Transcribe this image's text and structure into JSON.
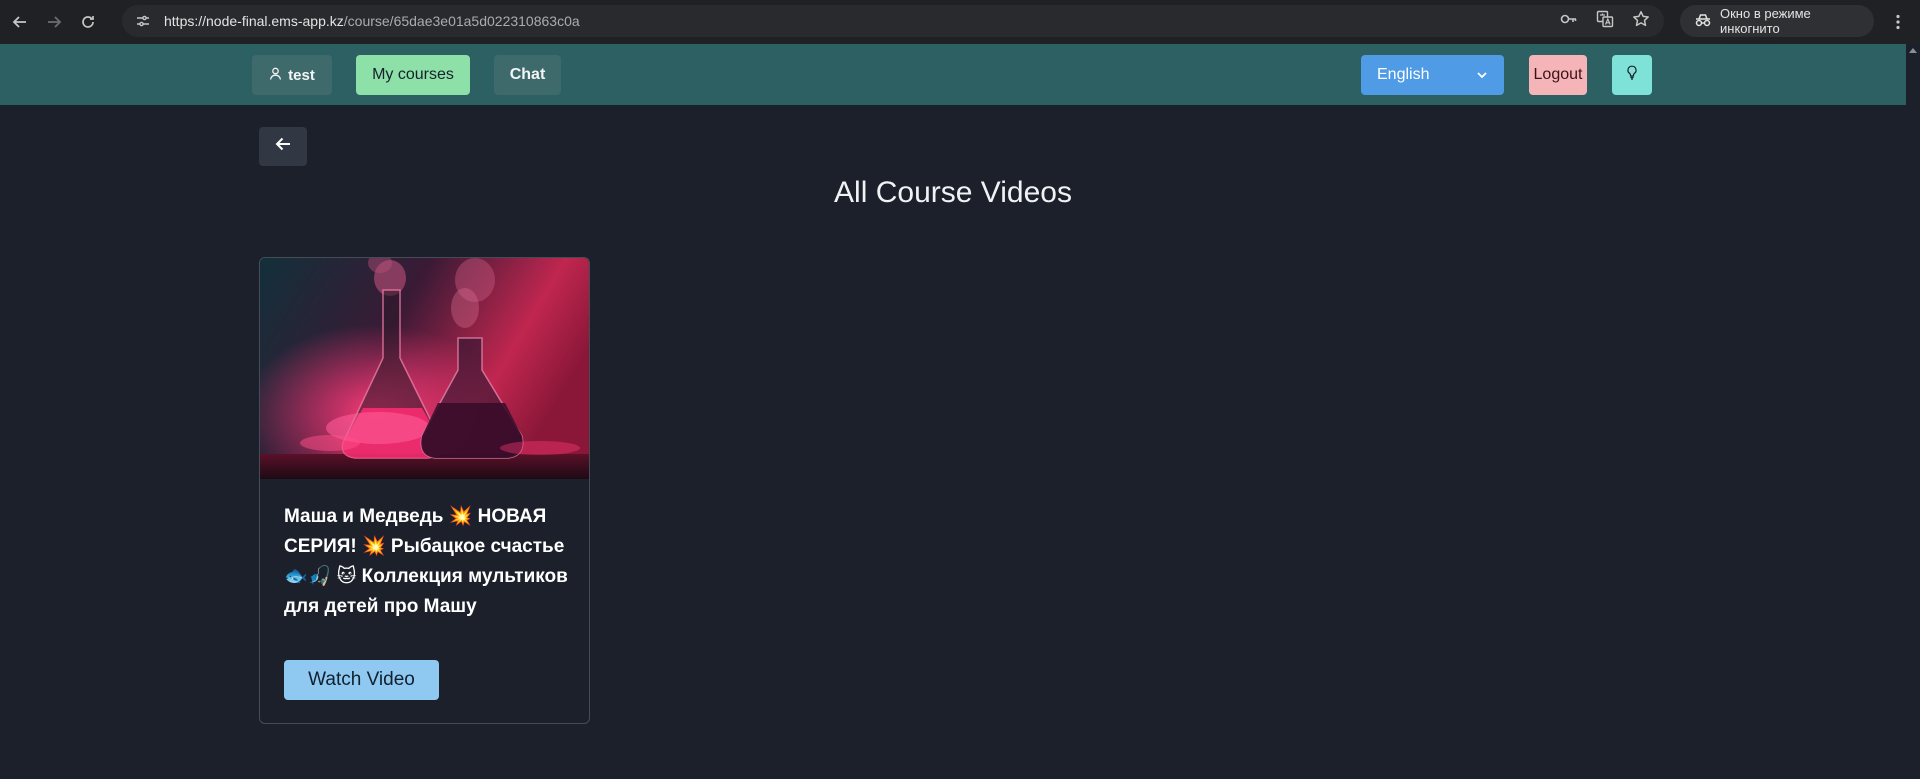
{
  "browser": {
    "url_host": "https://node-final.ems-app.kz",
    "url_path": "/course/65dae3e01a5d022310863c0a",
    "incognito_label": "Окно в режиме инкогнито",
    "icons": [
      "back-arrow-icon",
      "forward-arrow-icon",
      "reload-icon",
      "site-settings-icon",
      "key-icon",
      "translate-icon",
      "star-icon",
      "incognito-icon",
      "kebab-menu-icon"
    ]
  },
  "navbar": {
    "user_label": "test",
    "user_icon": "user-icon",
    "my_courses_label": "My courses",
    "chat_label": "Chat",
    "language_selected": "English",
    "logout_label": "Logout",
    "theme_icon": "lightbulb-icon",
    "colors": {
      "bar": "#2d6062",
      "courses": "#8ee0a9",
      "language": "#4f9be6",
      "logout": "#f5b4b7",
      "theme": "#7ee2d8"
    }
  },
  "main": {
    "back_icon": "arrow-left-icon",
    "title": "All Course Videos",
    "videos": [
      {
        "title": "Маша и Медведь 💥 НОВАЯ СЕРИЯ! 💥 Рыбацкое счастье 🐟🎣 🐱 Коллекция мультиков для детей про Машу",
        "button_label": "Watch Video",
        "thumbnail": "chemistry-flasks-pink-smoke-image"
      }
    ]
  }
}
